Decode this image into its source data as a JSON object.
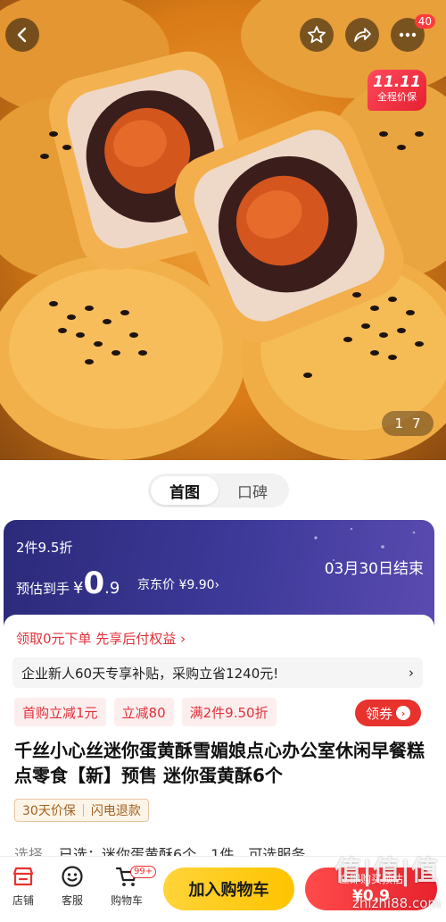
{
  "header": {
    "notification_count": "40",
    "promo_tag_big": "11.11",
    "promo_tag_small": "全程价保",
    "pager_current": "1",
    "pager_total": "7"
  },
  "tabs": [
    {
      "label": "首图"
    },
    {
      "label": "口碑"
    }
  ],
  "price_banner": {
    "multi_buy": "2件9.5折",
    "estimate_label": "预估到手",
    "currency": "¥",
    "price_int": "0",
    "price_dec": ".9",
    "jd_price": "京东价 ¥9.90",
    "jd_arrow": "›",
    "end_date": "03月30日结束"
  },
  "card": {
    "zero_pay": "领取0元下单 先享后付权益 ›",
    "subsidy_text": "企业新人60天专享补贴，采购立省1240元!",
    "subsidy_arrow": "›",
    "chips": [
      {
        "label": "首购立减1元"
      },
      {
        "label": "立减80"
      },
      {
        "label": "满2件9.50折"
      }
    ],
    "coupon_label": "领券",
    "coupon_arrow": "›",
    "title": "千丝小心丝迷你蛋黄酥雪媚娘点心办公室休闲早餐糕点零食【新】预售 迷你蛋黄酥6个",
    "service_tags": [
      "30天价保",
      "闪电退款"
    ],
    "select_label": "选择",
    "selected_text": "已选：迷你蛋黄酥6个，1件，可选服务"
  },
  "bottom_bar": {
    "shop_label": "店铺",
    "service_label": "客服",
    "cart_label": "购物车",
    "cart_count": "99+",
    "add_cart_label": "加入购物车",
    "buy_now_line1": "立即购买预估",
    "buy_now_line2": "¥0.9",
    "watermark_big": "值|值|值",
    "watermark_small": "zhizhi88.com"
  },
  "colors": {
    "accent_red": "#e8322e",
    "banner_purple": "#3d3a9a",
    "cart_yellow": "#ffc400"
  }
}
